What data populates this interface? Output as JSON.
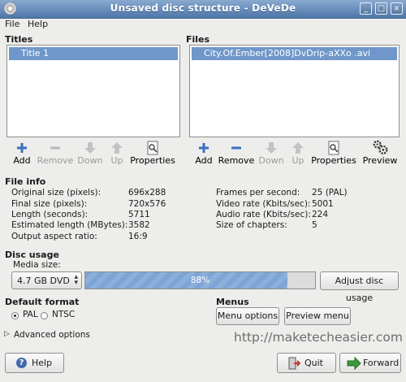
{
  "window": {
    "title": "Unsaved disc structure - DeVeDe",
    "controls": [
      "minimize-icon",
      "maximize-icon",
      "close-icon"
    ]
  },
  "menubar": {
    "file": "File",
    "help": "Help"
  },
  "titles_panel": {
    "heading": "Titles",
    "items": [
      {
        "label": "Title 1",
        "selected": true
      }
    ],
    "toolbar": {
      "add": "Add",
      "remove": "Remove",
      "down": "Down",
      "up": "Up",
      "properties": "Properties"
    }
  },
  "files_panel": {
    "heading": "Files",
    "items": [
      {
        "label": "City.Of.Ember[2008]DvDrip-aXXo .avi",
        "selected": true
      }
    ],
    "toolbar": {
      "add": "Add",
      "remove": "Remove",
      "down": "Down",
      "up": "Up",
      "properties": "Properties",
      "preview": "Preview"
    }
  },
  "file_info": {
    "heading": "File info",
    "left": [
      {
        "label": "Original size (pixels):",
        "value": "696x288"
      },
      {
        "label": "Final size (pixels):",
        "value": "720x576"
      },
      {
        "label": "Length (seconds):",
        "value": "5711"
      },
      {
        "label": "Estimated length (MBytes):",
        "value": "3582"
      },
      {
        "label": "Output aspect ratio:",
        "value": "16:9"
      }
    ],
    "right": [
      {
        "label": "Frames per second:",
        "value": "25 (PAL)"
      },
      {
        "label": "Video rate (Kbits/sec):",
        "value": "5001"
      },
      {
        "label": "Audio rate (Kbits/sec):",
        "value": "224"
      },
      {
        "label": "Size of chapters:",
        "value": "5"
      }
    ]
  },
  "disc_usage": {
    "heading": "Disc usage",
    "media_label": "Media size:",
    "media_value": "4.7 GB DVD",
    "progress_text": "88%",
    "progress_value": 0.88,
    "adjust_button": "Adjust disc usage"
  },
  "default_format": {
    "heading": "Default format",
    "options": [
      "PAL",
      "NTSC"
    ],
    "selected": "PAL"
  },
  "menus": {
    "heading": "Menus",
    "options_button": "Menu options",
    "preview_button": "Preview menu"
  },
  "advanced": {
    "label": "Advanced options"
  },
  "watermark": "http://maketecheasier.com",
  "footer": {
    "help": "Help",
    "quit": "Quit",
    "forward": "Forward"
  },
  "colors": {
    "titlebar": "#4d76ab",
    "selection": "#6f97c9",
    "progress": "#7ea4d5",
    "add_icon": "#3b6fc0",
    "quit_icon": "#c0392b",
    "forward_icon": "#3a9b3a"
  }
}
